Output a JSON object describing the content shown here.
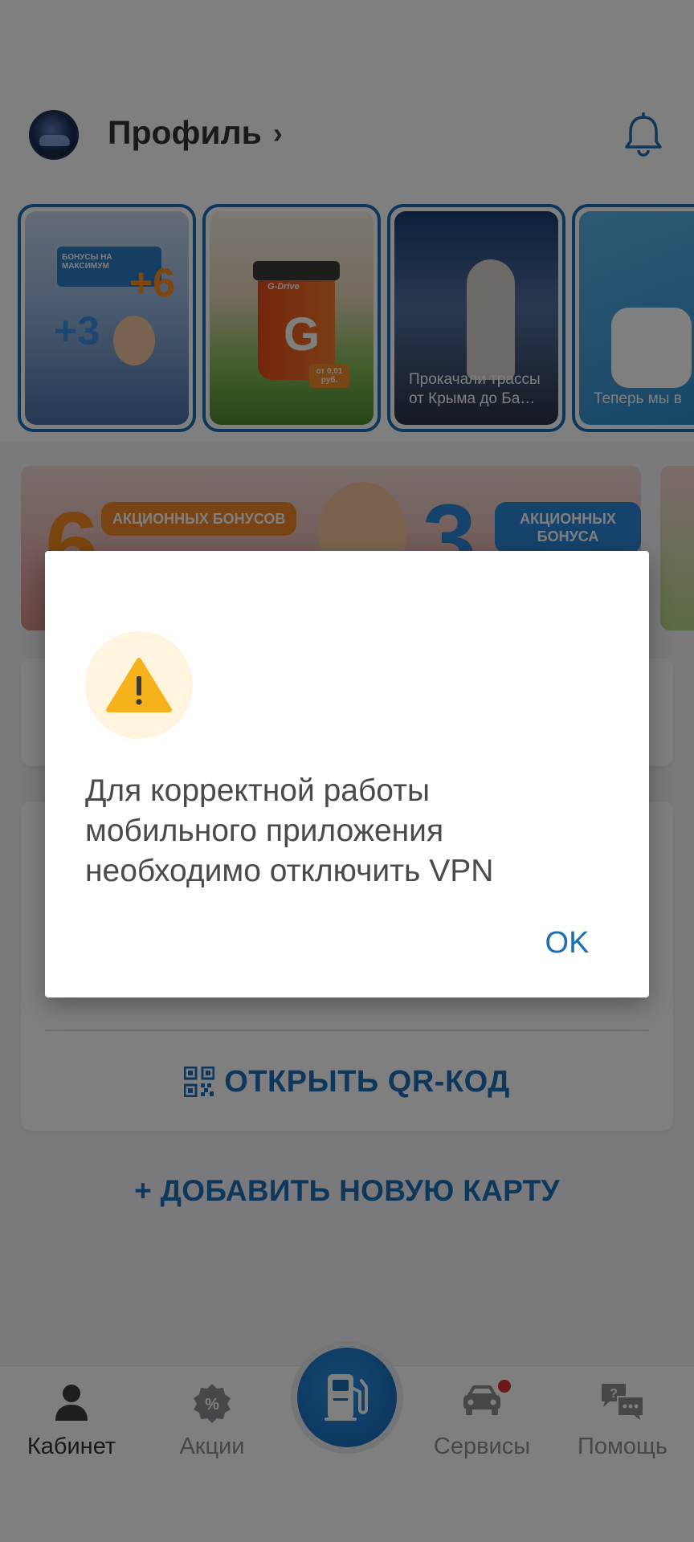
{
  "header": {
    "profile_label": "Профиль",
    "profile_chevron": "›"
  },
  "stories": [
    {
      "caption": "",
      "tag_line1": "БОНУСЫ НА МАКСИМУМ",
      "num_a": "+3",
      "num_b": "+6"
    },
    {
      "caption": "",
      "brand": "G-Drive",
      "price": "от 0,01 руб."
    },
    {
      "caption": "Прокачали трассы от Крыма до Ба…"
    },
    {
      "caption": "Теперь мы в"
    }
  ],
  "banner": {
    "num_left": "6",
    "pill_left": "АКЦИОННЫХ БОНУСОВ",
    "num_right": "3",
    "pill_right": "АКЦИОННЫХ БОНУСА"
  },
  "card2": {
    "qr_button_label": "ОТКРЫТЬ QR-КОД"
  },
  "add_card_label": "+ ДОБАВИТЬ НОВУЮ КАРТУ",
  "bottom_nav": {
    "items": [
      {
        "label": "Кабинет",
        "icon": "person-icon"
      },
      {
        "label": "Акции",
        "icon": "percent-badge-icon"
      },
      {
        "label": "",
        "icon": "fuel-pump-icon"
      },
      {
        "label": "Сервисы",
        "icon": "car-icon"
      },
      {
        "label": "Помощь",
        "icon": "chat-help-icon"
      }
    ]
  },
  "dialog": {
    "message": "Для корректной работы мобильного приложения необходимо отключить VPN",
    "ok_label": "OK",
    "icon": "warning-icon"
  },
  "colors": {
    "accent": "#1a6fb6",
    "warning": "#f6b21b",
    "warning_bg": "#fff4de",
    "badge": "#d9302c"
  }
}
